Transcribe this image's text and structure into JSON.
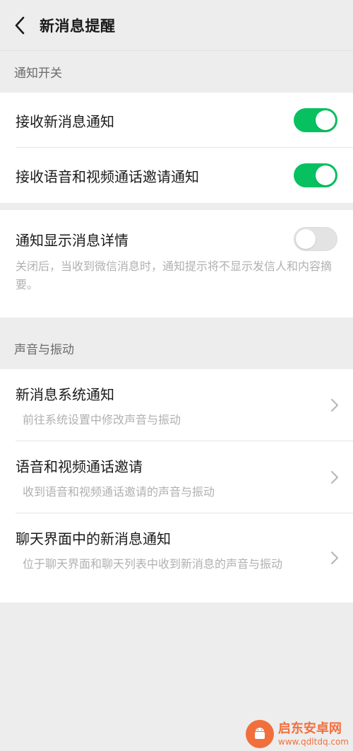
{
  "header": {
    "title": "新消息提醒"
  },
  "sections": {
    "notify_switch": {
      "label": "通知开关",
      "items": [
        {
          "label": "接收新消息通知",
          "enabled": true
        },
        {
          "label": "接收语音和视频通话邀请通知",
          "enabled": true
        }
      ]
    },
    "detail": {
      "label": "通知显示消息详情",
      "enabled": false,
      "description": "关闭后，当收到微信消息时，通知提示将不显示发信人和内容摘要。"
    },
    "sound_vibration": {
      "label": "声音与振动",
      "items": [
        {
          "title": "新消息系统通知",
          "subtitle": "前往系统设置中修改声音与振动"
        },
        {
          "title": "语音和视频通话邀请",
          "subtitle": "收到语音和视频通话邀请的声音与振动"
        },
        {
          "title": "聊天界面中的新消息通知",
          "subtitle": "位于聊天界面和聊天列表中收到新消息的声音与振动"
        }
      ]
    }
  },
  "colors": {
    "toggle_on": "#07c160",
    "toggle_off": "#e3e3e3",
    "page_background": "#ededed"
  },
  "icons": {
    "back": "back-arrow-icon",
    "chevron": "chevron-right-icon"
  },
  "watermark": {
    "name": "启东安卓网",
    "url": "www.qdltdq.com"
  }
}
